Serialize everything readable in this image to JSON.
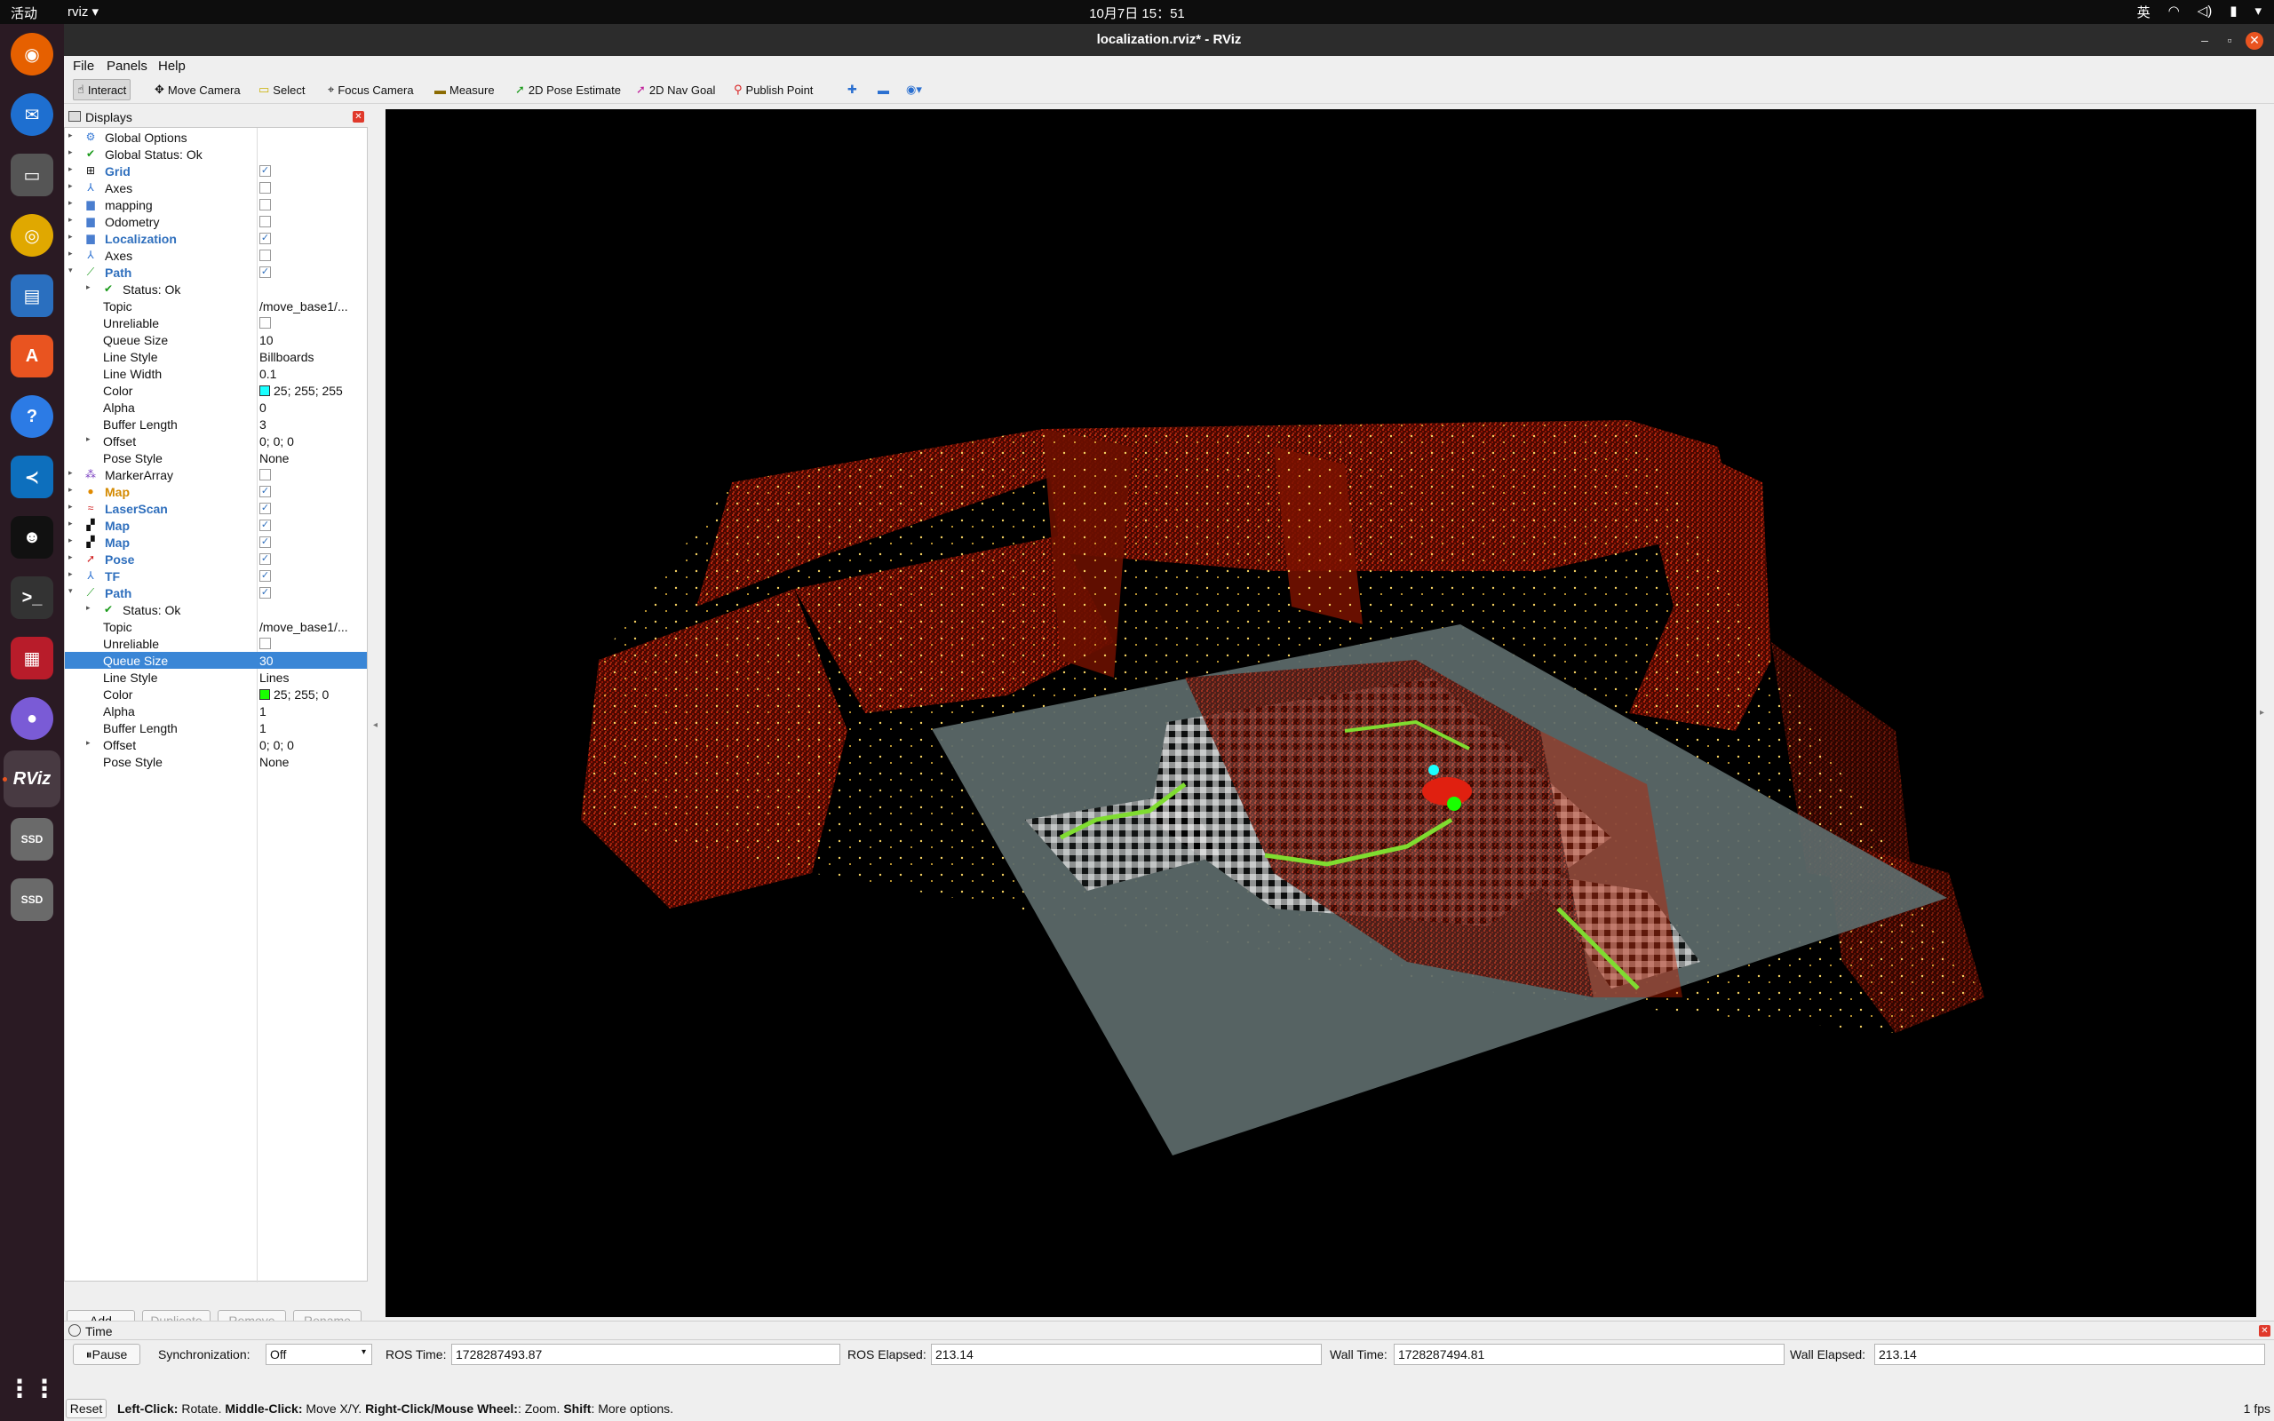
{
  "topbar": {
    "activities": "活动",
    "app_menu": "rviz",
    "clock": "10月7日  15：51",
    "ime": "英"
  },
  "window": {
    "title": "localization.rviz* - RViz"
  },
  "menubar": {
    "file": "File",
    "panels": "Panels",
    "help": "Help"
  },
  "toolbar": {
    "interact": "Interact",
    "move_camera": "Move Camera",
    "select": "Select",
    "focus_camera": "Focus Camera",
    "measure": "Measure",
    "pose_estimate": "2D Pose Estimate",
    "nav_goal": "2D Nav Goal",
    "publish_point": "Publish Point"
  },
  "displays": {
    "title": "Displays",
    "rows": [
      {
        "label": "Global Options"
      },
      {
        "label": "Global Status: Ok"
      },
      {
        "label": "Grid"
      },
      {
        "label": "Axes"
      },
      {
        "label": "mapping"
      },
      {
        "label": "Odometry"
      },
      {
        "label": "Localization"
      },
      {
        "label": "Axes"
      },
      {
        "label": "Path"
      },
      {
        "label": "Status: Ok"
      },
      {
        "label": "Topic",
        "value": "/move_base1/..."
      },
      {
        "label": "Unreliable"
      },
      {
        "label": "Queue Size",
        "value": "10"
      },
      {
        "label": "Line Style",
        "value": "Billboards"
      },
      {
        "label": "Line Width",
        "value": "0.1"
      },
      {
        "label": "Color",
        "value": "25; 255; 255"
      },
      {
        "label": "Alpha",
        "value": "0"
      },
      {
        "label": "Buffer Length",
        "value": "3"
      },
      {
        "label": "Offset",
        "value": "0; 0; 0"
      },
      {
        "label": "Pose Style",
        "value": "None"
      },
      {
        "label": "MarkerArray"
      },
      {
        "label": "Map"
      },
      {
        "label": "LaserScan"
      },
      {
        "label": "Map"
      },
      {
        "label": "Map"
      },
      {
        "label": "Pose"
      },
      {
        "label": "TF"
      },
      {
        "label": "Path"
      },
      {
        "label": "Status: Ok"
      },
      {
        "label": "Topic",
        "value": "/move_base1/..."
      },
      {
        "label": "Unreliable"
      },
      {
        "label": "Queue Size",
        "value": "30"
      },
      {
        "label": "Line Style",
        "value": "Lines"
      },
      {
        "label": "Color",
        "value": "25; 255; 0"
      },
      {
        "label": "Alpha",
        "value": "1"
      },
      {
        "label": "Buffer Length",
        "value": "1"
      },
      {
        "label": "Offset",
        "value": "0; 0; 0"
      },
      {
        "label": "Pose Style",
        "value": "None"
      }
    ],
    "colors": {
      "path1_color": "#19ffff",
      "path2_color": "#19ff00"
    },
    "buttons": {
      "add": "Add",
      "duplicate": "Duplicate",
      "remove": "Remove",
      "rename": "Rename"
    }
  },
  "time_panel": {
    "title": "Time",
    "pause": "Pause",
    "sync_label": "Synchronization:",
    "sync_value": "Off",
    "ros_time_label": "ROS Time:",
    "ros_time": "1728287493.87",
    "ros_elapsed_label": "ROS Elapsed:",
    "ros_elapsed": "213.14",
    "wall_time_label": "Wall Time:",
    "wall_time": "1728287494.81",
    "wall_elapsed_label": "Wall Elapsed:",
    "wall_elapsed": "213.14"
  },
  "statusbar": {
    "reset": "Reset",
    "hint_left": "Left-Click:",
    "hint_left_text": " Rotate. ",
    "hint_middle": "Middle-Click:",
    "hint_middle_text": " Move X/Y. ",
    "hint_right": "Right-Click/Mouse Wheel:",
    "hint_right_text": ": Zoom. ",
    "hint_shift": "Shift",
    "hint_shift_text": ": More options.",
    "fps": "1 fps"
  }
}
